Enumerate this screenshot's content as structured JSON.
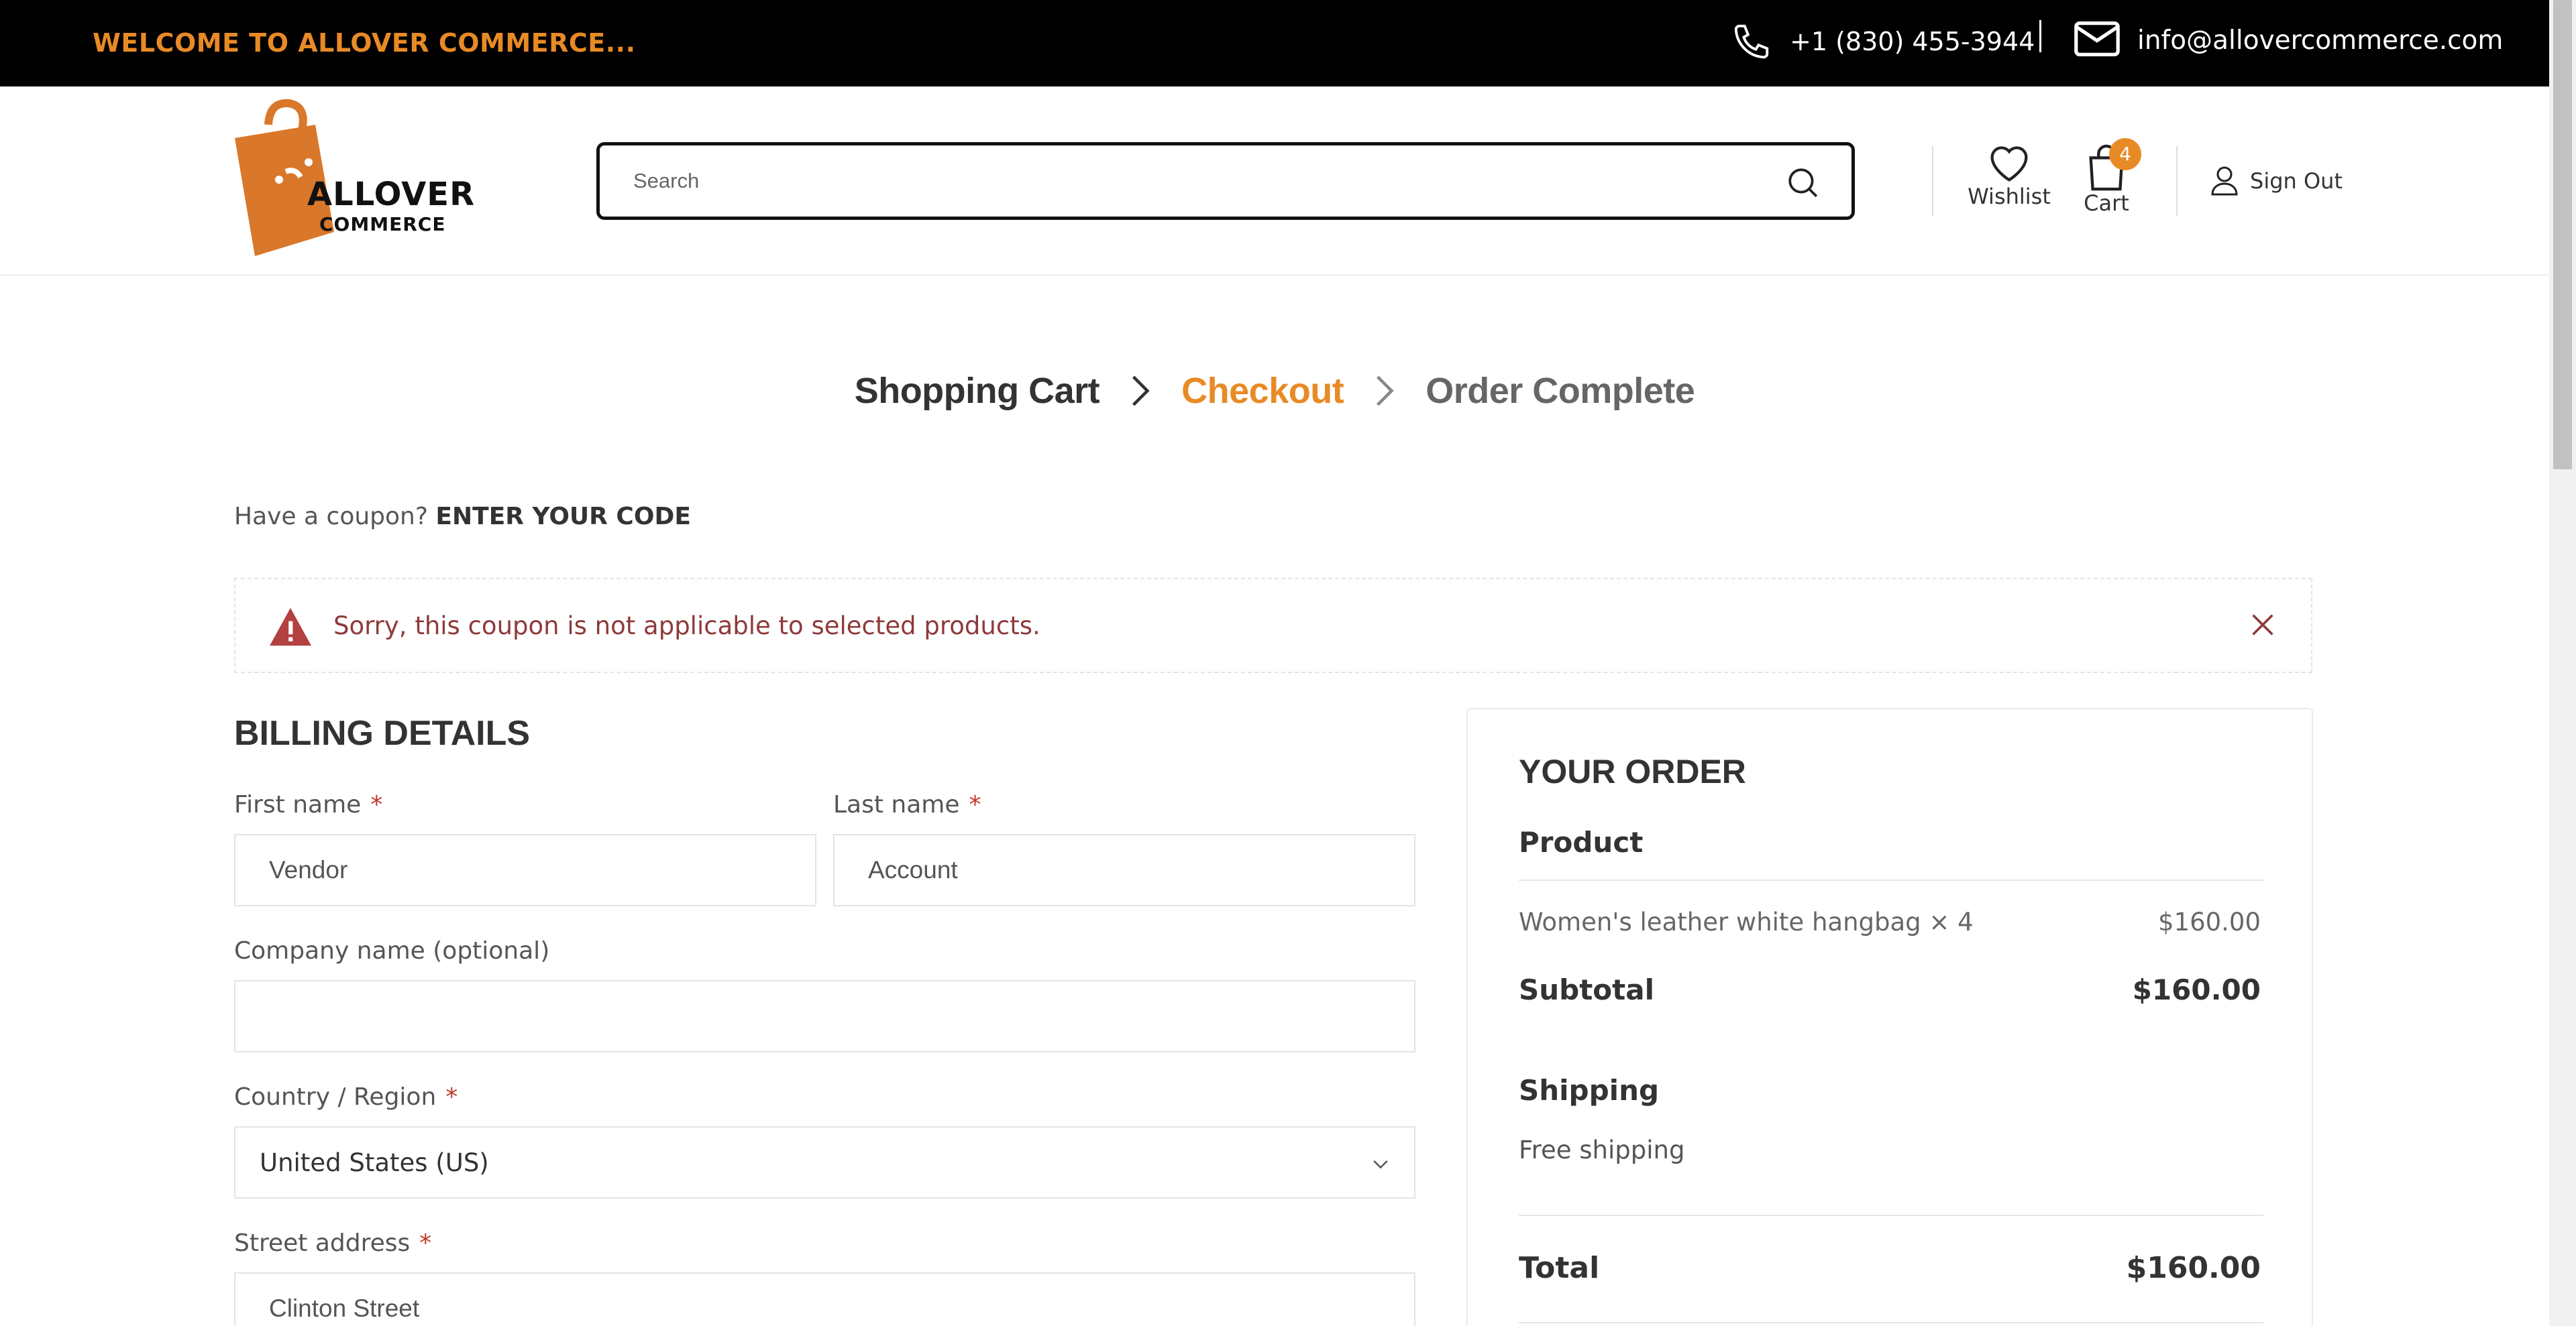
{
  "topbar": {
    "welcome": "WELCOME TO ALLOVER COMMERCE...",
    "phone": "+1 (830) 455-3944",
    "email": "info@allovercommerce.com"
  },
  "header": {
    "logo_main": "ALLOVER",
    "logo_sub": "COMMERCE",
    "search_placeholder": "Search",
    "wishlist_label": "Wishlist",
    "cart_label": "Cart",
    "cart_count": "4",
    "signout_label": "Sign Out"
  },
  "steps": {
    "cart": "Shopping Cart",
    "checkout": "Checkout",
    "complete": "Order Complete"
  },
  "coupon": {
    "prompt": "Have a coupon?",
    "link": "ENTER YOUR CODE"
  },
  "alert": {
    "message": "Sorry, this coupon is not applicable to selected products."
  },
  "billing": {
    "title": "BILLING DETAILS",
    "first_name_label": "First name",
    "first_name_value": "Vendor",
    "last_name_label": "Last name",
    "last_name_value": "Account",
    "company_label": "Company name (optional)",
    "company_value": "",
    "country_label": "Country / Region",
    "country_value": "United States (US)",
    "street_label": "Street address",
    "street_value": "Clinton Street",
    "required_mark": "*"
  },
  "order": {
    "title": "YOUR ORDER",
    "product_header": "Product",
    "item_name": "Women's leather white hangbag  × 4",
    "item_price": "$160.00",
    "subtotal_label": "Subtotal",
    "subtotal_value": "$160.00",
    "shipping_label": "Shipping",
    "shipping_value": "Free shipping",
    "total_label": "Total",
    "total_value": "$160.00"
  },
  "colors": {
    "accent": "#e88a25",
    "topbar_bg": "#000000",
    "error_text": "#8e3a3a",
    "required": "#c0392b"
  },
  "icons": [
    "phone-icon",
    "mail-icon",
    "search-icon",
    "heart-icon",
    "cart-bag-icon",
    "user-icon",
    "chevron-right-icon",
    "warning-icon",
    "close-icon",
    "chevron-down-icon"
  ]
}
